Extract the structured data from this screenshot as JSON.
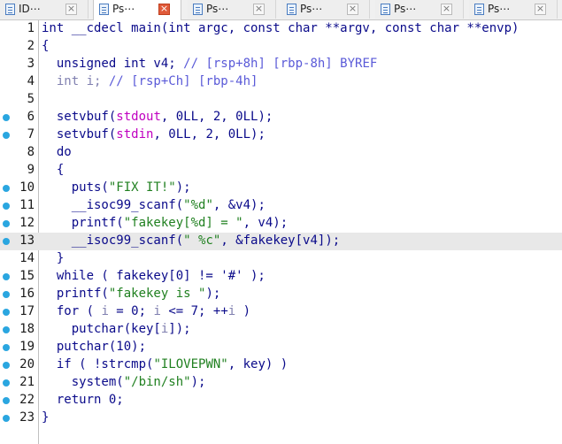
{
  "tabs": [
    {
      "label": "ID⋯",
      "active": false
    },
    {
      "label": "Ps⋯",
      "active": true
    },
    {
      "label": "Ps⋯",
      "active": false
    },
    {
      "label": "Ps⋯",
      "active": false
    },
    {
      "label": "Ps⋯",
      "active": false
    },
    {
      "label": "Ps⋯",
      "active": false
    }
  ],
  "close_glyph": "×",
  "highlight_line": 13,
  "colors": {
    "string": "#208020",
    "global": "#c000c0",
    "register_var": "#8080b0",
    "comment": "#5a5ad8",
    "breakpoint": "#2aa6e0",
    "highlight": "#e8e8e8"
  },
  "code_lines": [
    {
      "n": "1",
      "bp": false,
      "tokens": [
        [
          "int __cdecl main(int argc, const char **argv, const char **envp)",
          "v"
        ]
      ]
    },
    {
      "n": "2",
      "bp": false,
      "tokens": [
        [
          "{",
          "v"
        ]
      ]
    },
    {
      "n": "3",
      "bp": false,
      "tokens": [
        [
          "  unsigned int v4; ",
          "v"
        ],
        [
          "// [rsp+8h] [rbp-8h] BYREF",
          "cmt"
        ]
      ]
    },
    {
      "n": "4",
      "bp": false,
      "tokens": [
        [
          "  int i; ",
          "gray"
        ],
        [
          "// [rsp+Ch] [rbp-4h]",
          "cmt"
        ]
      ]
    },
    {
      "n": "5",
      "bp": false,
      "tokens": [
        [
          "",
          "v"
        ]
      ]
    },
    {
      "n": "6",
      "bp": true,
      "tokens": [
        [
          "  setvbuf(",
          "v"
        ],
        [
          "stdout",
          "glob"
        ],
        [
          ", 0LL, 2, 0LL);",
          "v"
        ]
      ]
    },
    {
      "n": "7",
      "bp": true,
      "tokens": [
        [
          "  setvbuf(",
          "v"
        ],
        [
          "stdin",
          "glob"
        ],
        [
          ", 0LL, 2, 0LL);",
          "v"
        ]
      ]
    },
    {
      "n": "8",
      "bp": false,
      "tokens": [
        [
          "  do",
          "v"
        ]
      ]
    },
    {
      "n": "9",
      "bp": false,
      "tokens": [
        [
          "  {",
          "v"
        ]
      ]
    },
    {
      "n": "10",
      "bp": true,
      "tokens": [
        [
          "    puts(",
          "v"
        ],
        [
          "\"FIX IT!\"",
          "str"
        ],
        [
          ");",
          "v"
        ]
      ]
    },
    {
      "n": "11",
      "bp": true,
      "tokens": [
        [
          "    __isoc99_scanf(",
          "v"
        ],
        [
          "\"%d\"",
          "str"
        ],
        [
          ", &v4);",
          "v"
        ]
      ]
    },
    {
      "n": "12",
      "bp": true,
      "tokens": [
        [
          "    printf(",
          "v"
        ],
        [
          "\"fakekey[%d] = \"",
          "str"
        ],
        [
          ", v4);",
          "v"
        ]
      ]
    },
    {
      "n": "13",
      "bp": true,
      "tokens": [
        [
          "    __isoc99_scanf(",
          "v"
        ],
        [
          "\" %c\"",
          "str"
        ],
        [
          ", &fakekey[v4]);",
          "v"
        ]
      ]
    },
    {
      "n": "14",
      "bp": false,
      "tokens": [
        [
          "  }",
          "v"
        ]
      ]
    },
    {
      "n": "15",
      "bp": true,
      "tokens": [
        [
          "  while ( fakekey[0] != '#' );",
          "v"
        ]
      ]
    },
    {
      "n": "16",
      "bp": true,
      "tokens": [
        [
          "  printf(",
          "v"
        ],
        [
          "\"fakekey is \"",
          "str"
        ],
        [
          ");",
          "v"
        ]
      ]
    },
    {
      "n": "17",
      "bp": true,
      "tokens": [
        [
          "  for ( ",
          "v"
        ],
        [
          "i",
          "gray"
        ],
        [
          " = 0; ",
          "v"
        ],
        [
          "i",
          "gray"
        ],
        [
          " <= 7; ++",
          "v"
        ],
        [
          "i",
          "gray"
        ],
        [
          " )",
          "v"
        ]
      ]
    },
    {
      "n": "18",
      "bp": true,
      "tokens": [
        [
          "    putchar(key[",
          "v"
        ],
        [
          "i",
          "gray"
        ],
        [
          "]);",
          "v"
        ]
      ]
    },
    {
      "n": "19",
      "bp": true,
      "tokens": [
        [
          "  putchar(10);",
          "v"
        ]
      ]
    },
    {
      "n": "20",
      "bp": true,
      "tokens": [
        [
          "  if ( !strcmp(",
          "v"
        ],
        [
          "\"ILOVEPWN\"",
          "str"
        ],
        [
          ", key) )",
          "v"
        ]
      ]
    },
    {
      "n": "21",
      "bp": true,
      "tokens": [
        [
          "    system(",
          "v"
        ],
        [
          "\"/bin/sh\"",
          "str"
        ],
        [
          ");",
          "v"
        ]
      ]
    },
    {
      "n": "22",
      "bp": true,
      "tokens": [
        [
          "  return 0;",
          "v"
        ]
      ]
    },
    {
      "n": "23",
      "bp": true,
      "tokens": [
        [
          "}",
          "v"
        ]
      ]
    }
  ]
}
